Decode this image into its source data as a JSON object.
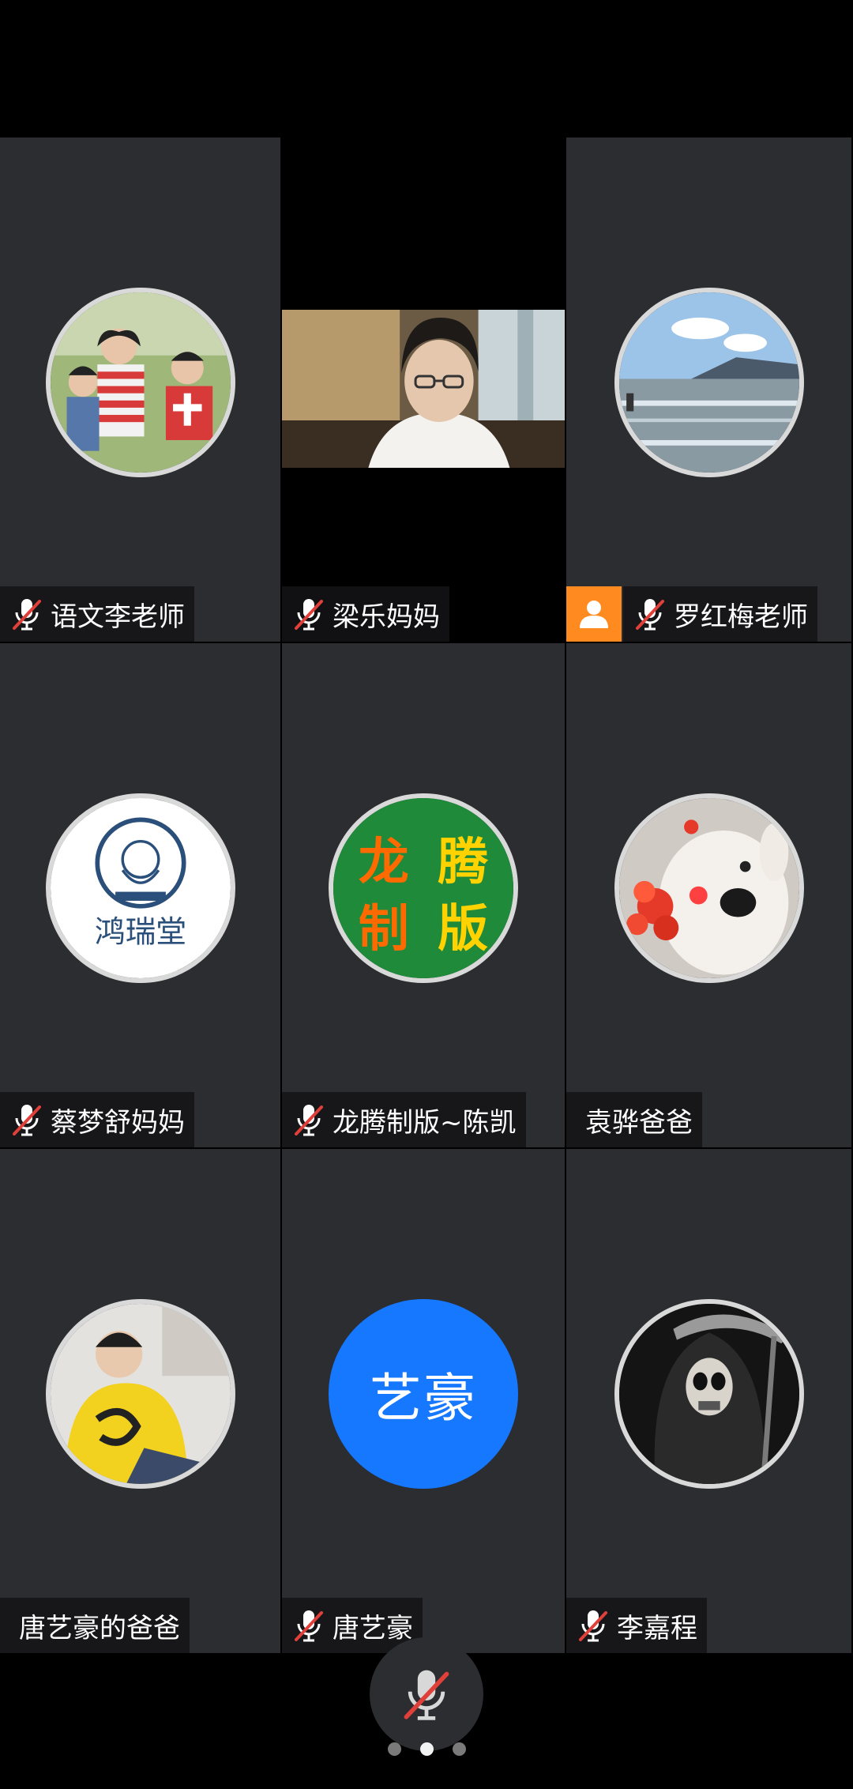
{
  "participants": [
    {
      "name": "语文李老师",
      "muted": true,
      "avatar": "family-photo"
    },
    {
      "name": "梁乐妈妈",
      "muted": true,
      "video": true
    },
    {
      "name": "罗红梅老师",
      "muted": true,
      "host": true,
      "avatar": "lake-photo"
    },
    {
      "name": "蔡梦舒妈妈",
      "muted": true,
      "avatar": "hongruitang-logo"
    },
    {
      "name": "龙腾制版~陈凯",
      "muted": true,
      "avatar": "longteng-logo"
    },
    {
      "name": "袁骅爸爸",
      "muted": false,
      "avatar": "dog-photo"
    },
    {
      "name": "唐艺豪的爸爸",
      "muted": false,
      "avatar": "man-photo"
    },
    {
      "name": "唐艺豪",
      "muted": true,
      "avatar_initials": "艺豪"
    },
    {
      "name": "李嘉程",
      "muted": true,
      "avatar": "skull-reaper-photo"
    }
  ],
  "logo_text": {
    "hongruitang": "鸿瑞堂",
    "longteng": [
      "龙",
      "腾",
      "制",
      "版"
    ]
  },
  "pager": {
    "pages": 3,
    "active": 2
  },
  "colors": {
    "tile_bg": "#2b2d30",
    "host_badge": "#ff8a1f",
    "initials_avatar": "#1677ff",
    "mute_slash": "#e0403a"
  }
}
